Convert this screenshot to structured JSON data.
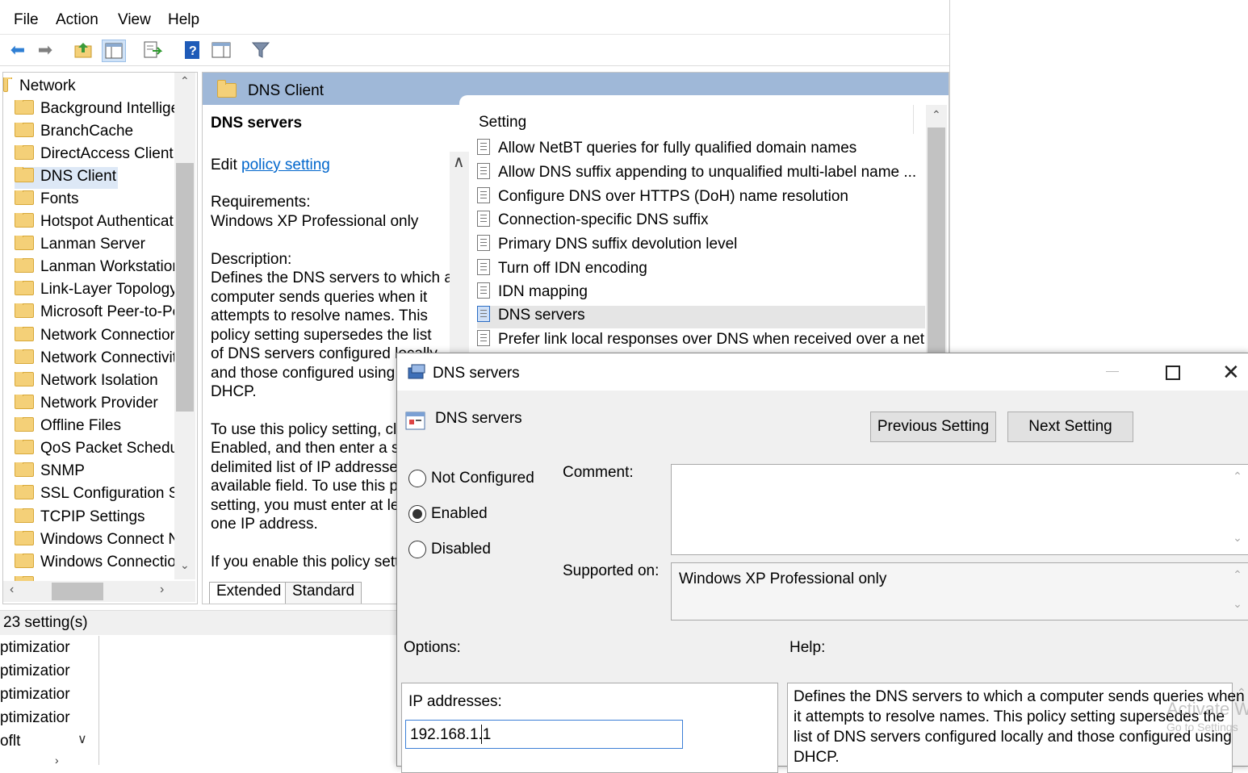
{
  "menu": [
    "File",
    "Action",
    "View",
    "Help"
  ],
  "toolbar_icons": [
    "back-arrow-icon",
    "forward-arrow-icon",
    "up-folder-icon",
    "show-hide-console-tree-icon",
    "export-list-icon",
    "help-icon",
    "show-hide-action-pane-icon",
    "filter-icon"
  ],
  "tree": {
    "items": [
      "Network",
      "Background Intellige",
      "BranchCache",
      "DirectAccess Client E",
      "DNS Client",
      "Fonts",
      "Hotspot Authenticat",
      "Lanman Server",
      "Lanman Workstatior",
      "Link-Layer Topology",
      "Microsoft Peer-to-Pe",
      "Network Connectior",
      "Network Connectivit",
      "Network Isolation",
      "Network Provider",
      "Offline Files",
      "QoS Packet Schedule",
      "SNMP",
      "SSL Configuration Se",
      "TCPIP Settings",
      "Windows Connect N",
      "Windows Connectio"
    ],
    "selected": "DNS Client"
  },
  "pane": {
    "header": "DNS Client",
    "desc_title": "DNS servers",
    "edit_prefix": "Edit",
    "edit_link": "policy setting",
    "requirements_label": "Requirements:",
    "requirements_value": "Windows XP Professional only",
    "description_label": "Description:",
    "description_lines": [
      "Defines the DNS servers to which a",
      "computer sends queries when it",
      "attempts to resolve names. This",
      "policy setting supersedes the list",
      "of DNS servers configured locally",
      "and those configured using",
      "DHCP."
    ],
    "usage_lines": [
      "To use this policy setting, cli",
      "Enabled, and then enter a sp",
      "delimited list of IP addresses",
      "available field. To use this po",
      "setting, you must enter at le",
      "one IP address."
    ],
    "if_enable_line": "If you enable this policy sett",
    "column_header": "Setting",
    "settings": [
      "Allow NetBT queries for fully qualified domain names",
      "Allow DNS suffix appending to unqualified multi-label name ...",
      "Configure DNS over HTTPS (DoH) name resolution",
      "Connection-specific DNS suffix",
      "Primary DNS suffix devolution level",
      "Turn off IDN encoding",
      "IDN mapping",
      "DNS servers",
      "Prefer link local responses over DNS when received over a net..."
    ],
    "selected_setting": "DNS servers",
    "tabs": [
      "Extended",
      "Standard"
    ]
  },
  "status": "23 setting(s)",
  "lower_list": [
    "ptimizatior",
    "ptimizatior",
    "ptimizatior",
    "ptimizatior",
    "oflt"
  ],
  "dialog": {
    "title": "DNS servers",
    "setting_name": "DNS servers",
    "prev_button": "Previous Setting",
    "next_button": "Next Setting",
    "radios": [
      "Not Configured",
      "Enabled",
      "Disabled"
    ],
    "selected_radio": "Enabled",
    "comment_label": "Comment:",
    "comment_value": "",
    "supported_label": "Supported on:",
    "supported_value": "Windows XP Professional only",
    "options_label": "Options:",
    "help_label": "Help:",
    "ip_label": "IP addresses:",
    "ip_value": "192.168.1.1",
    "help_lines": [
      "Defines the DNS servers to which a computer sends queries when",
      "it attempts to resolve names. This policy setting supersedes the",
      "list of DNS servers configured locally and those configured using",
      "DHCP."
    ],
    "watermark_1": "Activate W",
    "watermark_2": "Go to Settings"
  },
  "colors": {
    "header_blue": "#9fb8d8",
    "link_blue": "#0066cc",
    "selected_row": "#e5e5e5",
    "folder_yellow": "#f4d078"
  }
}
